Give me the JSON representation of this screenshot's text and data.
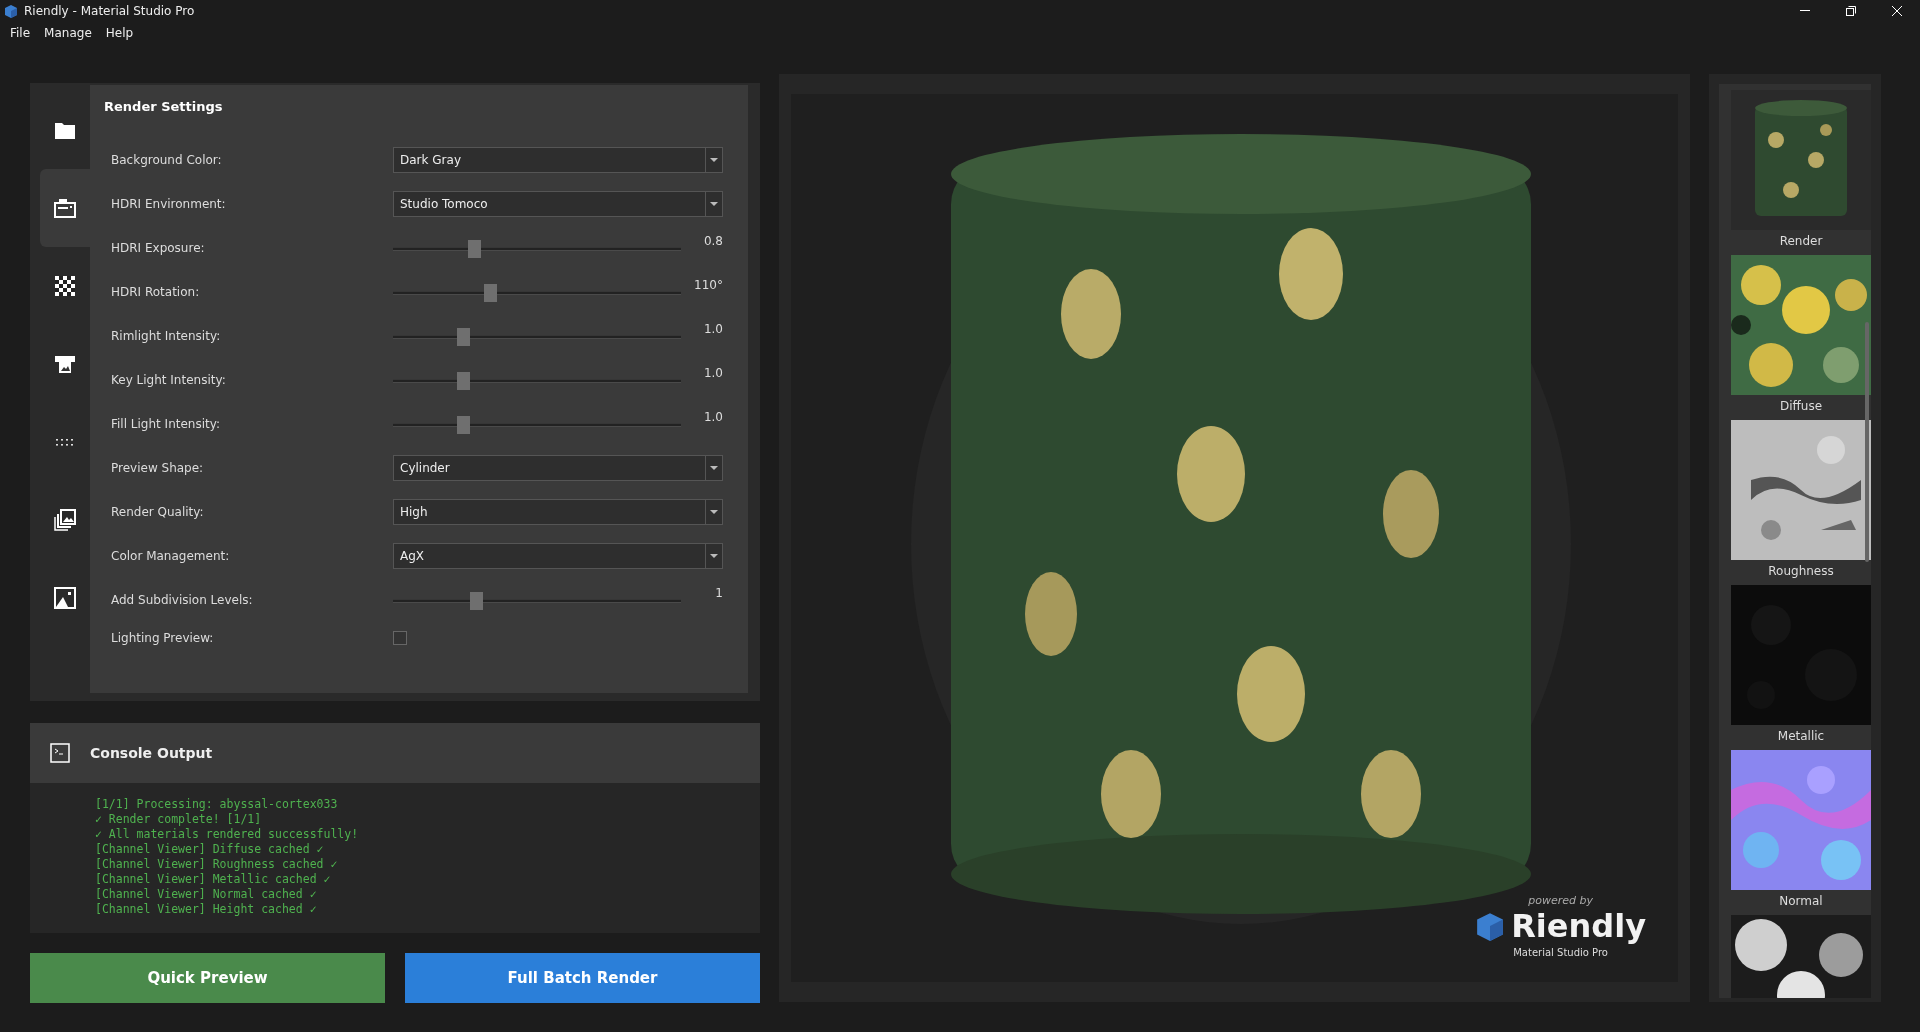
{
  "window": {
    "title": "Riendly - Material Studio Pro"
  },
  "menu": [
    "File",
    "Manage",
    "Help"
  ],
  "sidebar": {
    "items": [
      {
        "selected": false
      },
      {
        "selected": true
      },
      {
        "selected": false
      },
      {
        "selected": false
      },
      {
        "selected": false
      },
      {
        "selected": false
      },
      {
        "selected": false
      }
    ]
  },
  "render_settings": {
    "title": "Render Settings",
    "rows": [
      {
        "kind": "dropdown",
        "label": "Background Color:",
        "value": "Dark Gray"
      },
      {
        "kind": "dropdown",
        "label": "HDRI Environment:",
        "value": "Studio Tomoco"
      },
      {
        "kind": "slider",
        "label": "HDRI Exposure:",
        "level": 0.26,
        "reading": "0.8"
      },
      {
        "kind": "slider",
        "label": "HDRI Rotation:",
        "level": 0.32,
        "reading": "110°"
      },
      {
        "kind": "slider",
        "label": "Rimlight Intensity:",
        "level": 0.22,
        "reading": "1.0"
      },
      {
        "kind": "slider",
        "label": "Key Light Intensity:",
        "level": 0.22,
        "reading": "1.0"
      },
      {
        "kind": "slider",
        "label": "Fill Light Intensity:",
        "level": 0.22,
        "reading": "1.0"
      },
      {
        "kind": "dropdown",
        "label": "Preview Shape:",
        "value": "Cylinder"
      },
      {
        "kind": "dropdown",
        "label": "Render Quality:",
        "value": "High"
      },
      {
        "kind": "dropdown",
        "label": "Color Management:",
        "value": "AgX"
      },
      {
        "kind": "slider",
        "label": "Add Subdivision Levels:",
        "level": 0.27,
        "reading": "1"
      },
      {
        "kind": "checkbox",
        "label": "Lighting Preview:",
        "checked": false
      }
    ]
  },
  "console": {
    "title": "Console Output",
    "lines": [
      "[1/1] Processing: abyssal-cortex033",
      "✓ Render complete! [1/1]",
      "✓ All materials rendered successfully!",
      "[Channel Viewer] Diffuse cached ✓",
      "[Channel Viewer] Roughness cached ✓",
      "[Channel Viewer] Metallic cached ✓",
      "[Channel Viewer] Normal cached ✓",
      "[Channel Viewer] Height cached ✓"
    ]
  },
  "buttons": [
    {
      "label": "Quick Preview",
      "color": "#4a8a4b"
    },
    {
      "label": "Full Batch Render",
      "color": "#2b7fd9"
    }
  ],
  "preview": {
    "kind": "picture",
    "branding": {
      "tagline": "powered by",
      "name": "Riendly",
      "product": "Material Studio Pro"
    }
  },
  "channels": [
    {
      "kind": "picture",
      "label": "Render"
    },
    {
      "kind": "picture",
      "label": "Diffuse"
    },
    {
      "kind": "picture",
      "label": "Roughness"
    },
    {
      "kind": "picture",
      "label": "Metallic"
    },
    {
      "kind": "picture",
      "label": "Normal"
    },
    {
      "kind": "picture"
    }
  ]
}
